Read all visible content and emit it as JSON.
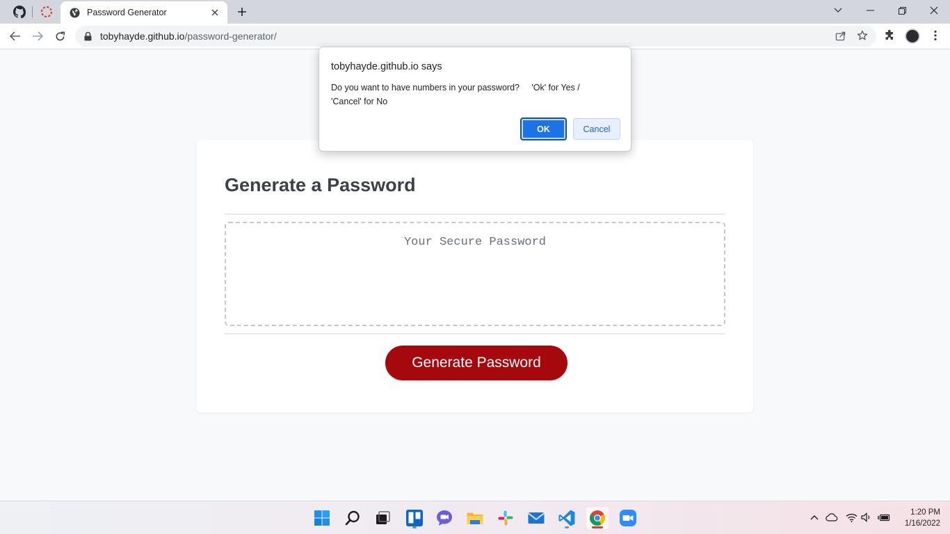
{
  "browser": {
    "tab_title": "Password Generator",
    "url_host": "tobyhayde.github.io",
    "url_path": "/password-generator/"
  },
  "page": {
    "heading": "Generate a Password",
    "password_placeholder": "Your Secure Password",
    "generate_button": "Generate Password",
    "accent_color": "#a5090e"
  },
  "dialog": {
    "title": "tobyhayde.github.io says",
    "message_line1": "Do you want to have numbers in your password?     'Ok' for Yes /",
    "message_line2": "'Cancel' for No",
    "ok_label": "OK",
    "cancel_label": "Cancel"
  },
  "taskbar": {
    "apps": [
      "start-icon",
      "search-icon",
      "task-view-icon",
      "trello-icon",
      "teams-chat-icon",
      "file-explorer-icon",
      "slack-icon",
      "mail-icon",
      "vscode-icon",
      "chrome-icon",
      "zoom-icon"
    ],
    "time": "1:20 PM",
    "date": "1/16/2022"
  }
}
